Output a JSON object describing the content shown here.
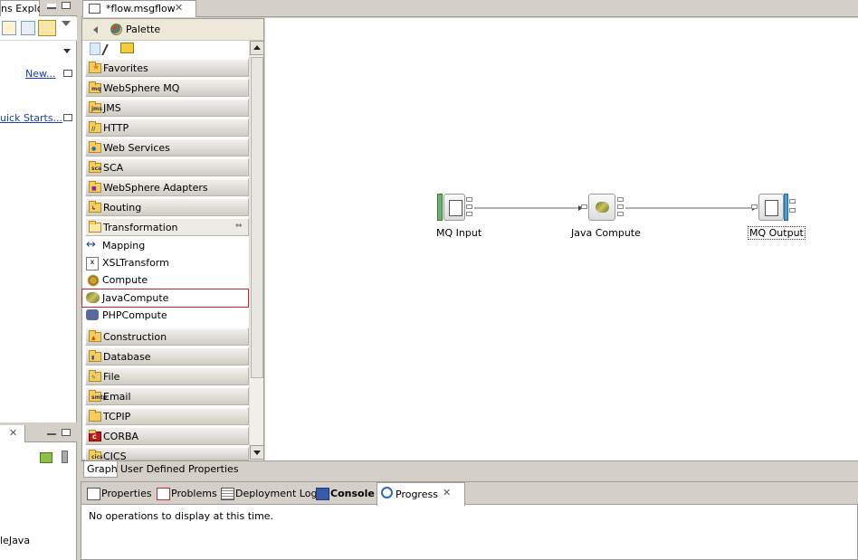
{
  "left_views": {
    "top_tab_label": "ns Explor",
    "links": [
      {
        "label": "New..."
      },
      {
        "label": "uick Starts..."
      }
    ],
    "bottom_text": "leJava"
  },
  "editor": {
    "tab_label": "*flow.msgflow"
  },
  "palette": {
    "title": "Palette",
    "categories": [
      {
        "label": "Favorites",
        "icon": "favorites-folder-icon"
      },
      {
        "label": "WebSphere MQ",
        "icon": "mq-folder-icon"
      },
      {
        "label": "JMS",
        "icon": "jms-folder-icon"
      },
      {
        "label": "HTTP",
        "icon": "http-folder-icon"
      },
      {
        "label": "Web Services",
        "icon": "web-services-folder-icon"
      },
      {
        "label": "SCA",
        "icon": "sca-folder-icon"
      },
      {
        "label": "WebSphere Adapters",
        "icon": "adapters-folder-icon"
      },
      {
        "label": "Routing",
        "icon": "routing-folder-icon"
      },
      {
        "label": "Transformation",
        "icon": "transformation-folder-icon"
      }
    ],
    "transformation_items": [
      {
        "label": "Mapping",
        "icon": "mapping-icon"
      },
      {
        "label": "XSLTransform",
        "icon": "xsl-transform-icon"
      },
      {
        "label": "Compute",
        "icon": "compute-icon"
      },
      {
        "label": "JavaCompute",
        "icon": "java-compute-icon",
        "selected": true
      },
      {
        "label": "PHPCompute",
        "icon": "php-compute-icon"
      }
    ],
    "categories_after": [
      {
        "label": "Construction",
        "icon": "construction-folder-icon"
      },
      {
        "label": "Database",
        "icon": "database-folder-icon"
      },
      {
        "label": "File",
        "icon": "file-folder-icon"
      },
      {
        "label": "Email",
        "icon": "email-folder-icon"
      },
      {
        "label": "TCPIP",
        "icon": "tcpip-folder-icon"
      },
      {
        "label": "CORBA",
        "icon": "corba-folder-icon"
      },
      {
        "label": "CICS",
        "icon": "cics-folder-icon"
      }
    ]
  },
  "canvas": {
    "nodes": [
      {
        "label": "MQ Input"
      },
      {
        "label": "Java Compute"
      },
      {
        "label": "MQ Output"
      }
    ]
  },
  "editor_tabs": [
    "Graph",
    "User Defined Properties"
  ],
  "bottom_panel": {
    "tabs": [
      {
        "label": "Properties",
        "icon": "properties-icon"
      },
      {
        "label": "Problems",
        "icon": "problems-icon"
      },
      {
        "label": "Deployment Log",
        "icon": "deployment-log-icon"
      },
      {
        "label": "Console",
        "icon": "console-icon"
      },
      {
        "label": "Progress",
        "icon": "progress-icon"
      }
    ],
    "message": "No operations to display at this time."
  }
}
